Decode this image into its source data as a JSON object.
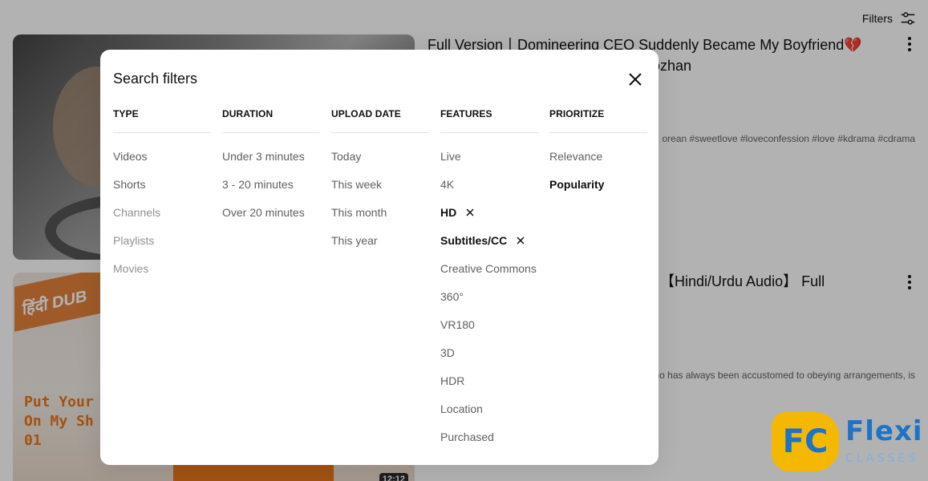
{
  "header": {
    "filters_label": "Filters"
  },
  "results": [
    {
      "title": "Full Version丨Domineering CEO Suddenly Became My Boyfriend💔",
      "subtitle_fragment": "ozhan",
      "desc": "orean #sweetlove #loveconfession #love #kdrama #cdrama"
    },
    {
      "title": "【Hindi/Urdu Audio】 Full episode",
      "desc": "no has always been accustomed to obeying arrangements, is",
      "thumb_banner": "हिंदी DUB",
      "thumb_text": "Put Your\nOn My Sh\n01",
      "duration": "12:12"
    }
  ],
  "dialog": {
    "title": "Search filters",
    "columns": [
      {
        "heading": "TYPE",
        "options": [
          {
            "label": "Videos",
            "state": "normal"
          },
          {
            "label": "Shorts",
            "state": "normal"
          },
          {
            "label": "Channels",
            "state": "dim"
          },
          {
            "label": "Playlists",
            "state": "dim"
          },
          {
            "label": "Movies",
            "state": "dim"
          }
        ]
      },
      {
        "heading": "DURATION",
        "options": [
          {
            "label": "Under 3 minutes",
            "state": "normal"
          },
          {
            "label": "3 - 20 minutes",
            "state": "normal"
          },
          {
            "label": "Over 20 minutes",
            "state": "normal"
          }
        ]
      },
      {
        "heading": "UPLOAD DATE",
        "options": [
          {
            "label": "Today",
            "state": "normal"
          },
          {
            "label": "This week",
            "state": "normal"
          },
          {
            "label": "This month",
            "state": "normal"
          },
          {
            "label": "This year",
            "state": "normal"
          }
        ]
      },
      {
        "heading": "FEATURES",
        "options": [
          {
            "label": "Live",
            "state": "normal"
          },
          {
            "label": "4K",
            "state": "normal"
          },
          {
            "label": "HD",
            "state": "selected"
          },
          {
            "label": "Subtitles/CC",
            "state": "selected"
          },
          {
            "label": "Creative Commons",
            "state": "normal"
          },
          {
            "label": "360°",
            "state": "normal"
          },
          {
            "label": "VR180",
            "state": "normal"
          },
          {
            "label": "3D",
            "state": "normal"
          },
          {
            "label": "HDR",
            "state": "normal"
          },
          {
            "label": "Location",
            "state": "normal"
          },
          {
            "label": "Purchased",
            "state": "normal"
          }
        ]
      },
      {
        "heading": "PRIORITIZE",
        "options": [
          {
            "label": "Relevance",
            "state": "normal"
          },
          {
            "label": "Popularity",
            "state": "selected"
          }
        ]
      }
    ]
  },
  "logo": {
    "badge": "FC",
    "name": "Flexi",
    "sub": "CLASSES"
  },
  "colors": {
    "scrim": "#000000",
    "logo_yellow": "#f5b800",
    "logo_blue": "#1e73c7",
    "thumb_orange": "#e8761e"
  }
}
